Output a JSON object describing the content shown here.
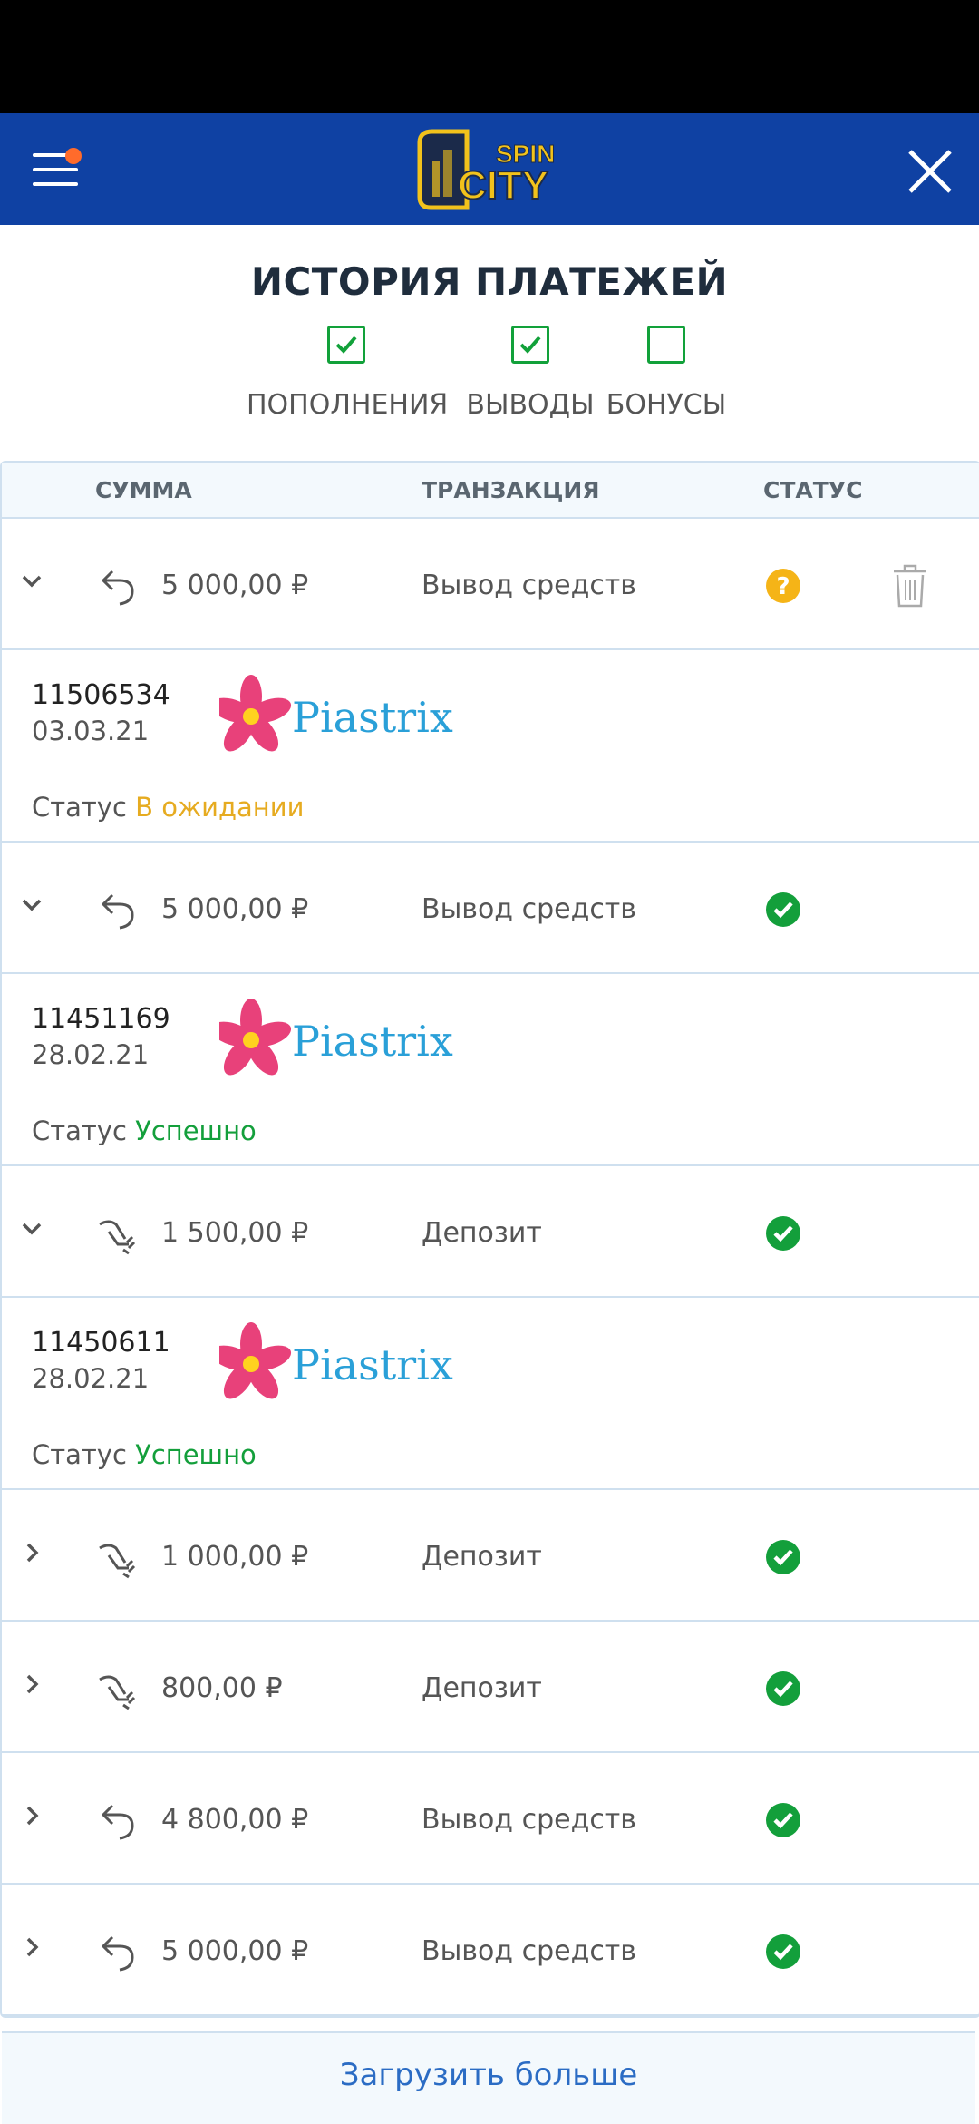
{
  "app": {
    "logo_text_top": "SPIN",
    "logo_text_bottom": "CITY"
  },
  "page": {
    "title": "ИСТОРИЯ ПЛАТЕЖЕЙ"
  },
  "filters": [
    {
      "label": "ПОПОЛНЕНИЯ",
      "checked": true
    },
    {
      "label": "ВЫВОДЫ",
      "checked": true
    },
    {
      "label": "БОНУСЫ",
      "checked": false
    }
  ],
  "table": {
    "headers": {
      "amount": "СУММА",
      "transaction": "ТРАНЗАКЦИЯ",
      "status": "СТАТУС"
    },
    "status_prefix": "Статус",
    "provider": "Piastrix",
    "rows": [
      {
        "amount": "5 000,00 ₽",
        "type": "Вывод средств",
        "expanded": true,
        "id": "11506534",
        "date": "03.03.21",
        "status_text": "В ожидании"
      },
      {
        "amount": "5 000,00 ₽",
        "type": "Вывод средств",
        "expanded": true,
        "id": "11451169",
        "date": "28.02.21",
        "status_text": "Успешно"
      },
      {
        "amount": "1 500,00 ₽",
        "type": "Депозит",
        "expanded": true,
        "id": "11450611",
        "date": "28.02.21",
        "status_text": "Успешно"
      },
      {
        "amount": "1 000,00 ₽",
        "type": "Депозит",
        "expanded": false
      },
      {
        "amount": "800,00 ₽",
        "type": "Депозит",
        "expanded": false
      },
      {
        "amount": "4 800,00 ₽",
        "type": "Вывод средств",
        "expanded": false
      },
      {
        "amount": "5 000,00 ₽",
        "type": "Вывод средств",
        "expanded": false
      }
    ]
  },
  "load_more": "Загрузить больше",
  "colors": {
    "header": "#0f41a3",
    "success": "#139f3b",
    "pending": "#f5b417",
    "link": "#2b6cc4"
  }
}
